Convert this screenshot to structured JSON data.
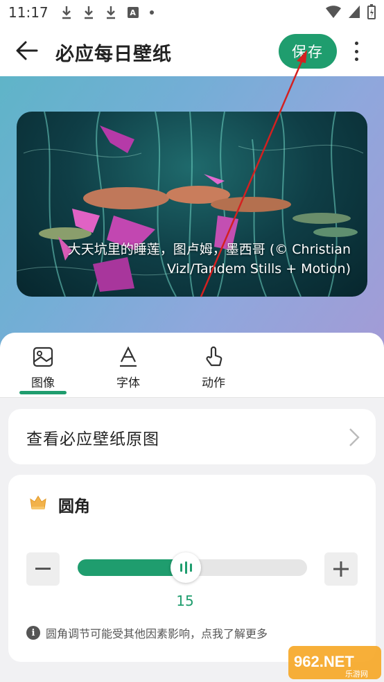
{
  "status_bar": {
    "time": "11:17"
  },
  "app_bar": {
    "title": "必应每日壁纸",
    "save_label": "保存"
  },
  "wallpaper": {
    "caption": "大天坑里的睡莲，图卢姆，墨西哥 (© Christian Vizl/Tandem Stills + Motion)"
  },
  "tabs": [
    {
      "label": "图像",
      "icon": "image-icon",
      "active": true
    },
    {
      "label": "字体",
      "icon": "font-icon",
      "active": false
    },
    {
      "label": "动作",
      "icon": "touch-icon",
      "active": false
    }
  ],
  "view_original": {
    "label": "查看必应壁纸原图"
  },
  "corner": {
    "title": "圆角",
    "value": "15",
    "level_fraction": 0.47,
    "hint": "圆角调节可能受其他因素影响，点我了解更多"
  },
  "watermark": {
    "text": "962.NET",
    "subtext": "乐游网"
  },
  "colors": {
    "accent": "#1f9d6e",
    "annotation": "#d42020"
  }
}
